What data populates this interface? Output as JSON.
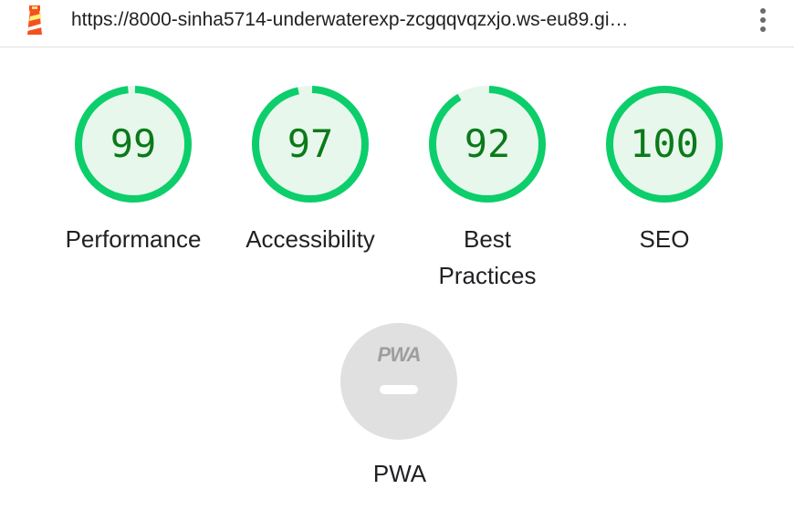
{
  "browser": {
    "url": "https://8000-sinha5714-underwaterexp-zcgqqvqzxjo.ws-eu89.gi…",
    "logo_icon": "lighthouse-icon",
    "menu_icon": "kebab-menu-icon"
  },
  "categories": [
    {
      "label": "Performance",
      "score": 99,
      "color": "#0cce6b"
    },
    {
      "label": "Accessibility",
      "score": 97,
      "color": "#0cce6b"
    },
    {
      "label": "Best Practices",
      "score": 92,
      "color": "#0cce6b"
    },
    {
      "label": "SEO",
      "score": 100,
      "color": "#0cce6b"
    }
  ],
  "pwa": {
    "badge_text": "PWA",
    "label": "PWA",
    "icon": "pwa-badge-icon"
  },
  "colors": {
    "pass": "#0cce6b",
    "score_text": "#0b7a1a",
    "gauge_fill": "#e8f7ec",
    "pwa_gray": "#e0e0e0"
  }
}
